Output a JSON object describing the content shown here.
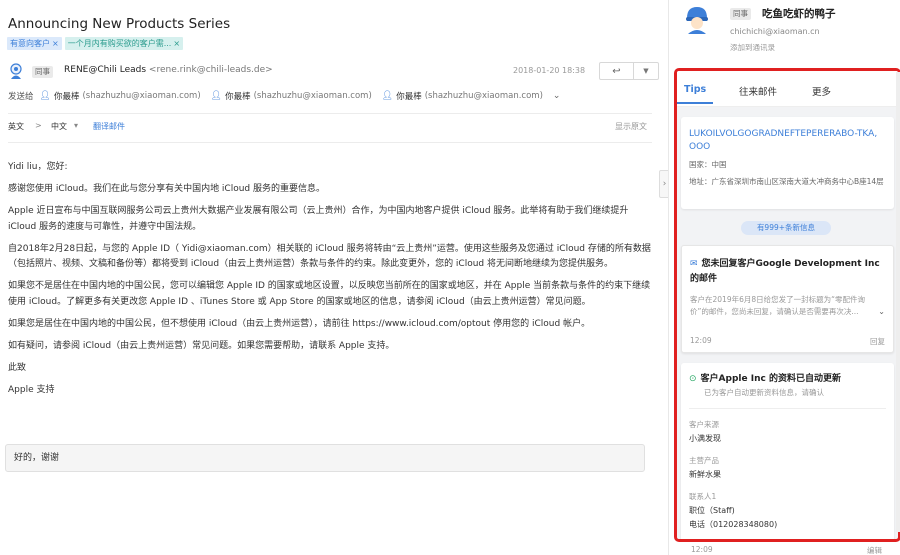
{
  "mail": {
    "subject": "Announcing New Products Series",
    "tags": [
      {
        "label": "有意向客户",
        "close": "×"
      },
      {
        "label": "一个月内有购买欲的客户需...",
        "close": "×"
      }
    ],
    "sender": {
      "badge": "同事",
      "name": "RENE@Chili Leads",
      "email": "<rene.rink@chili-leads.de>",
      "date": "2018-01-20 18:38",
      "reply_icon": "↩",
      "more_icon": "▼"
    },
    "to": {
      "label": "发送给",
      "recipients": [
        {
          "name": "你最棒",
          "email": "(shazhuzhu@xiaoman.com)"
        },
        {
          "name": "你最棒",
          "email": "(shazhuzhu@xiaoman.com)"
        },
        {
          "name": "你最棒",
          "email": "(shazhuzhu@xiaoman.com)"
        }
      ],
      "expand_icon": "⌄"
    },
    "translate": {
      "from": "英文",
      "arrow": ">",
      "to": "中文",
      "dropdown": "▾",
      "action": "翻译邮件",
      "show_original": "显示原文"
    },
    "body": [
      "Yidi liu，您好:",
      "感谢您使用 iCloud。我们在此与您分享有关中国内地 iCloud 服务的重要信息。",
      "Apple 近日宣布与中国互联网服务公司云上贵州大数据产业发展有限公司（云上贵州）合作，为中国内地客户提供 iCloud 服务。此举将有助于我们继续提升 iCloud 服务的速度与可靠性，并遵守中国法规。",
      "自2018年2月28日起，与您的 Apple ID（ Yidi@xiaoman.com）相关联的 iCloud 服务将转由“云上贵州”运营。使用这些服务及您通过 iCloud 存储的所有数据（包括照片、视频、文稿和备份等）都将受到 iCloud（由云上贵州运营）条款与条件的约束。除此变更外，您的 iCloud 将无间断地继续为您提供服务。",
      "如果您不是居住在中国内地的中国公民，您可以编辑您 Apple ID 的国家或地区设置，以反映您当前所在的国家或地区，并在 Apple 当前条款与条件的约束下继续使用 iCloud。了解更多有关更改您 Apple ID 、iTunes Store 或 App Store 的国家或地区的信息，请参阅 iCloud（由云上贵州运营）常见问题。",
      "如果您是居住在中国内地的中国公民，但不想使用 iCloud（由云上贵州运营），请前往 https://www.icloud.com/optout 停用您的 iCloud 帐户。",
      "如有疑问，请参阅 iCloud（由云上贵州运营）常见问题。如果您需要帮助，请联系 Apple 支持。",
      "此致",
      "Apple 支持"
    ],
    "quick_reply": "好的，谢谢",
    "collapse_icon": "›"
  },
  "panel": {
    "contact": {
      "badge": "同事",
      "name": "吃鱼吃虾的鸭子",
      "email": "chichichi@xiaoman.cn",
      "add": "添加到通讯录"
    },
    "tabs": [
      "Tips",
      "往来邮件",
      "更多"
    ],
    "company_card": {
      "name": "LUKOILVOLGOGRADNEFTEPERERABO-TKA, OOO",
      "country": "国家：中国",
      "address": "地址：广东省深圳市南山区深南大道大冲商务中心B座14层"
    },
    "more_info": "有999+条新信息",
    "reply_card": {
      "icon": "✉",
      "title": "您未回复客户Google Development Inc 的邮件",
      "desc": "客户在2019年6月8日给您发了一封标题为“零配件询价”的邮件，您尚未回复，请确认是否需要再次决...",
      "chevron": "⌄",
      "time": "12:09",
      "action": "回复"
    },
    "update_card": {
      "icon": "⊙",
      "title": "客户Apple Inc 的资料已自动更新",
      "subtitle": "已为客户自动更新资料信息，请确认",
      "fields": [
        {
          "label": "客户来源",
          "value": "小满发现"
        },
        {
          "label": "主营产品",
          "value": "新鲜水果"
        },
        {
          "label": "联系人1",
          "value": "职位（Staff)"
        }
      ],
      "extra_value": "电话（012028348080)",
      "time": "12:09",
      "action": "编辑"
    }
  },
  "colors": {
    "accent": "#3d7fd8",
    "highlight_border": "#e02020",
    "update_icon": "#2aa866"
  }
}
